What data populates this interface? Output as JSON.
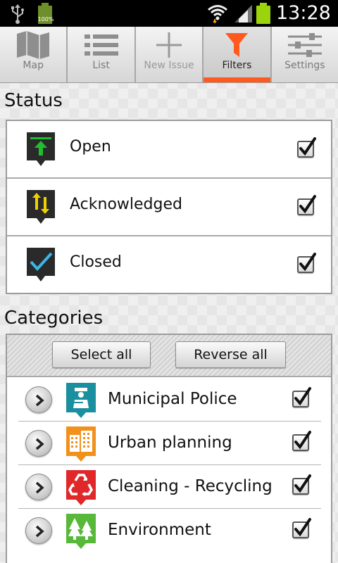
{
  "status_bar": {
    "battery_percent_small": "100%",
    "time": "13:28"
  },
  "tabs": [
    {
      "label": "Map",
      "icon": "map-icon"
    },
    {
      "label": "List",
      "icon": "list-icon"
    },
    {
      "label": "New Issue",
      "icon": "plus-icon"
    },
    {
      "label": "Filters",
      "icon": "funnel-icon",
      "active": true
    },
    {
      "label": "Settings",
      "icon": "sliders-icon"
    }
  ],
  "status_section": {
    "title": "Status",
    "items": [
      {
        "label": "Open",
        "checked": true,
        "icon": "open-status-icon",
        "color": "#1fbf2e"
      },
      {
        "label": "Acknowledged",
        "checked": true,
        "icon": "acknowledged-status-icon",
        "color": "#f2d000"
      },
      {
        "label": "Closed",
        "checked": true,
        "icon": "closed-status-icon",
        "color": "#3ab7e8"
      }
    ]
  },
  "categories_section": {
    "title": "Categories",
    "select_all_label": "Select all",
    "reverse_all_label": "Reverse all",
    "items": [
      {
        "label": "Municipal Police",
        "checked": true,
        "icon": "police-icon",
        "color": "#1a8fa0"
      },
      {
        "label": "Urban planning",
        "checked": true,
        "icon": "buildings-icon",
        "color": "#f2901c"
      },
      {
        "label": "Cleaning - Recycling",
        "checked": true,
        "icon": "recycle-icon",
        "color": "#e0282a"
      },
      {
        "label": "Environment",
        "checked": true,
        "icon": "trees-icon",
        "color": "#58b83a"
      }
    ]
  },
  "colors": {
    "accent": "#ff5a1e",
    "statusbar": "#000000"
  }
}
